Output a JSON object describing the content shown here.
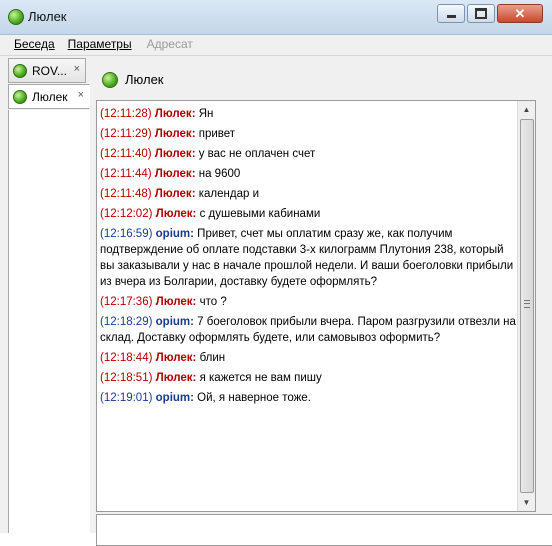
{
  "window": {
    "title": "Люлек"
  },
  "menu": {
    "items": [
      "Беседа",
      "Параметры",
      "Адресат"
    ]
  },
  "tabs": [
    {
      "label": "ROV...",
      "close": "×"
    },
    {
      "label": "Люлек",
      "close": "×"
    }
  ],
  "contact": {
    "name": "Люлек"
  },
  "messages": [
    {
      "time": "(12:11:28)",
      "nick": "Люлек:",
      "text": "Ян",
      "dir": "in"
    },
    {
      "time": "(12:11:29)",
      "nick": "Люлек:",
      "text": "привет",
      "dir": "in"
    },
    {
      "time": "(12:11:40)",
      "nick": "Люлек:",
      "text": "у вас не оплачен счет",
      "dir": "in"
    },
    {
      "time": "(12:11:44)",
      "nick": "Люлек:",
      "text": "на 9600",
      "dir": "in"
    },
    {
      "time": "(12:11:48)",
      "nick": "Люлек:",
      "text": "календар и",
      "dir": "in"
    },
    {
      "time": "(12:12:02)",
      "nick": "Люлек:",
      "text": "с душевыми кабинами",
      "dir": "in"
    },
    {
      "time": "(12:16:59)",
      "nick": "opium:",
      "text": "Привет, счет мы оплатим сразу же, как получим подтверждение об оплате подставки 3-х килограмм Плутония 238, который вы заказывали у нас в начале прошлой недели. И ваши боеголовки прибыли из вчера из Болгарии, доставку будете оформлять?",
      "dir": "out"
    },
    {
      "time": "(12:17:36)",
      "nick": "Люлек:",
      "text": "что ?",
      "dir": "in"
    },
    {
      "time": "(12:18:29)",
      "nick": "opium:",
      "text": "7 боеголовок прибыли вчера. Паром разгрузили отвезли на склад. Доставку оформлять будете, или самовывоз оформить?",
      "dir": "out"
    },
    {
      "time": "(12:18:44)",
      "nick": "Люлек:",
      "text": "блин",
      "dir": "in"
    },
    {
      "time": "(12:18:51)",
      "nick": "Люлек:",
      "text": "я кажется не вам пишу",
      "dir": "in"
    },
    {
      "time": "(12:19:01)",
      "nick": "opium:",
      "text": "Ой, я наверное тоже.",
      "dir": "out"
    }
  ],
  "colors": {
    "incoming": "#b00000",
    "outgoing": "#1a3c8f"
  },
  "icons": {
    "status": "online-green-dot-icon"
  }
}
